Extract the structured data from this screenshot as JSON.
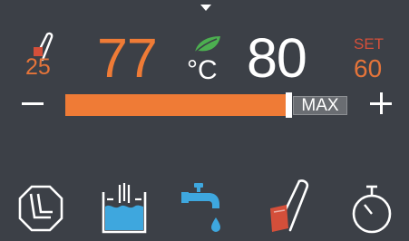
{
  "probe": {
    "icon": "core-probe-icon",
    "value": "25"
  },
  "current_temperature": "77",
  "eco_icon": "leaf-icon",
  "temperature_unit": "°C",
  "target_temperature": "80",
  "set": {
    "label": "SET",
    "value": "60"
  },
  "controls": {
    "decrease_icon": "minus-icon",
    "increase_icon": "plus-icon"
  },
  "slider": {
    "level_fraction": 0.79,
    "max_label": "MAX"
  },
  "bottom_bar": [
    {
      "name": "timer-mode-icon"
    },
    {
      "name": "water-tank-icon"
    },
    {
      "name": "water-tap-icon"
    },
    {
      "name": "core-probe-icon"
    },
    {
      "name": "stopwatch-icon"
    }
  ],
  "colors": {
    "background": "#3c4047",
    "accent_orange": "#ef7b36",
    "set_red": "#d44f3a",
    "eco_green": "#4caf50",
    "water_blue": "#3ea7de"
  }
}
